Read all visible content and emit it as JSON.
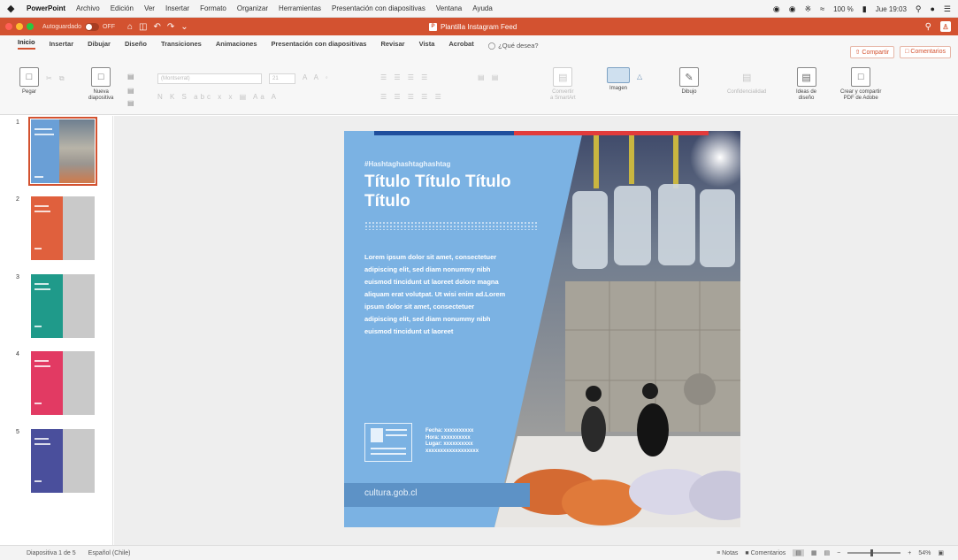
{
  "menubar": {
    "apple": "",
    "items": [
      "PowerPoint",
      "Archivo",
      "Edición",
      "Ver",
      "Insertar",
      "Formato",
      "Organizar",
      "Herramientas",
      "Presentación con diapositivas",
      "Ventana",
      "Ayuda"
    ],
    "battery": "100 %",
    "clock": "Jue 19:03"
  },
  "titlebar": {
    "autosave_label": "Autoguardado",
    "autosave_state": "OFF",
    "document_title": "Plantilla Instagram Feed"
  },
  "ribbon_tabs": [
    "Inicio",
    "Insertar",
    "Dibujar",
    "Diseño",
    "Transiciones",
    "Animaciones",
    "Presentación con diapositivas",
    "Revisar",
    "Vista",
    "Acrobat"
  ],
  "tell_me": "¿Qué desea?",
  "share": {
    "share_label": "Compartir",
    "comments_label": "Comentarios"
  },
  "ribbon": {
    "paste": "Pegar",
    "new_slide": "Nueva\ndiapositiva",
    "font_name": "(Montserrat)",
    "font_size": "21",
    "convert_smartart": "Convertir\na SmartArt",
    "image": "Imagen",
    "draw": "Dibujo",
    "sensitivity": "Confidencialidad",
    "design_ideas": "Ideas de\ndiseño",
    "create_pdf": "Crear y compartir\nPDF de Adobe"
  },
  "thumbnails": [
    {
      "number": "1",
      "color": "#6a9fd6",
      "selected": true
    },
    {
      "number": "2",
      "color": "#e0603d",
      "selected": false
    },
    {
      "number": "3",
      "color": "#1f9a8a",
      "selected": false
    },
    {
      "number": "4",
      "color": "#e23a63",
      "selected": false
    },
    {
      "number": "5",
      "color": "#4a4f9c",
      "selected": false
    }
  ],
  "slide": {
    "hashtag": "#Hashtaghashtaghashtag",
    "title": "Título Título Título Título",
    "body": "Lorem ipsum dolor sit amet, consectetuer adipiscing elit, sed diam nonummy nibh euismod tincidunt ut laoreet dolore magna aliquam erat volutpat. Ut wisi enim ad.Lorem ipsum dolor sit amet, consectetuer adipiscing elit, sed diam nonummy nibh euismod tincidunt ut laoreet",
    "info": "Fecha: xxxxxxxxxx\nHora: xxxxxxxxxx\nLugar: xxxxxxxxxx\nxxxxxxxxxxxxxxxxxx",
    "footer_url": "cultura.gob.cl"
  },
  "statusbar": {
    "slide_counter": "Diapositiva 1 de 5",
    "language": "Español (Chile)",
    "notes": "Notas",
    "comments": "Comentarios",
    "zoom": "54%"
  },
  "colors": {
    "accent": "#d35230",
    "slide_blue": "#7bb2e3",
    "footer_blue": "#5d92c6",
    "top_bar_blue": "#1f4e9c",
    "top_bar_red": "#e23b3b"
  }
}
